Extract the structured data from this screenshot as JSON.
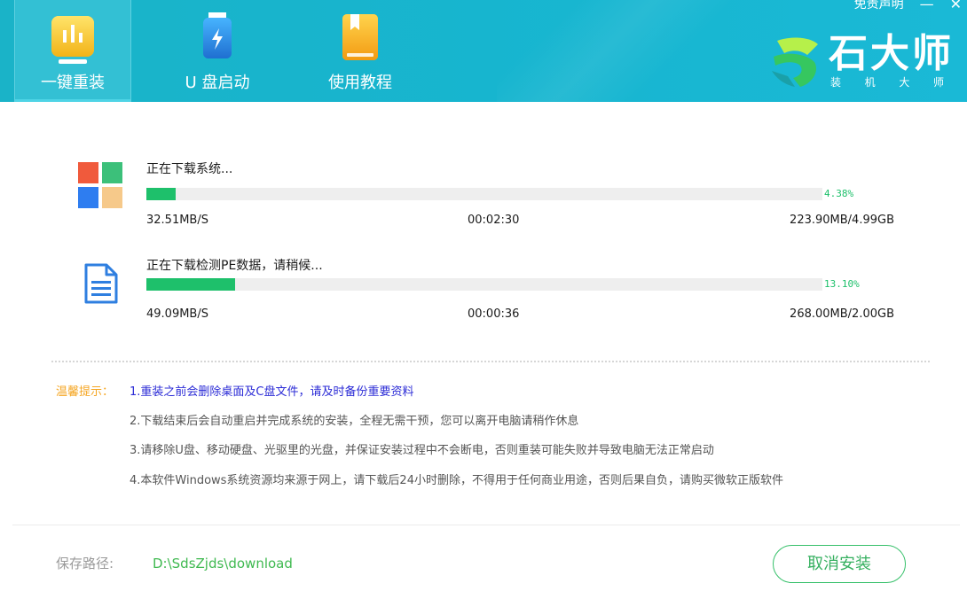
{
  "header": {
    "tabs": [
      {
        "label": "一键重装",
        "icon": "chart-bars-icon",
        "active": true
      },
      {
        "label": "U 盘启动",
        "icon": "usb-drive-icon",
        "active": false
      },
      {
        "label": "使用教程",
        "icon": "book-icon",
        "active": false
      }
    ],
    "disclaimer": "免责声明",
    "brand": {
      "name": "石大师",
      "sub": [
        "装",
        "机",
        "大",
        "师"
      ]
    }
  },
  "downloads": [
    {
      "icon": "windows-logo-icon",
      "title": "正在下载系统...",
      "percent_text": "4.38%",
      "progress": 0.0438,
      "speed": "32.51MB/S",
      "time": "00:02:30",
      "size": "223.90MB/4.99GB"
    },
    {
      "icon": "document-icon",
      "title": "正在下载检测PE数据，请稍候...",
      "percent_text": "13.10%",
      "progress": 0.131,
      "speed": "49.09MB/S",
      "time": "00:00:36",
      "size": "268.00MB/2.00GB"
    }
  ],
  "tips": {
    "label": "温馨提示：",
    "items": [
      "1.重装之前会删除桌面及C盘文件，请及时备份重要资料",
      "2.下载结束后会自动重启并完成系统的安装，全程无需干预，您可以离开电脑请稍作休息",
      "3.请移除U盘、移动硬盘、光驱里的光盘，并保证安装过程中不会断电，否则重装可能失败并导致电脑无法正常启动",
      "4.本软件Windows系统资源均来源于网上，请下载后24小时删除，不得用于任何商业用途，否则后果自负，请购买微软正版软件"
    ]
  },
  "footer": {
    "path_label": "保存路径:",
    "path_value": "D:\\SdsZjds\\download",
    "cancel_label": "取消安装"
  },
  "colors": {
    "header": "#17b5cf",
    "progress": "#1ec06b",
    "tip_label": "#f5a623",
    "tip_emphasis": "#2b2bd6"
  }
}
